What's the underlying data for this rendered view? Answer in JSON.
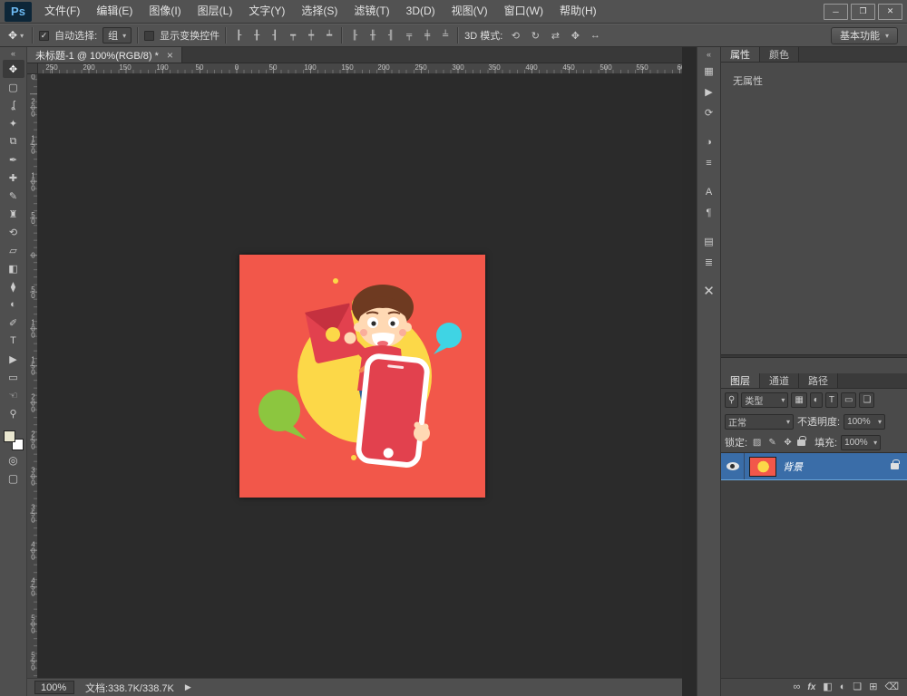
{
  "app": {
    "logo": "Ps",
    "menu": {
      "items": [
        "文件(F)",
        "编辑(E)",
        "图像(I)",
        "图层(L)",
        "文字(Y)",
        "选择(S)",
        "滤镜(T)",
        "3D(D)",
        "视图(V)",
        "窗口(W)",
        "帮助(H)"
      ]
    },
    "window_controls": {
      "minimize": "─",
      "maximize": "❐",
      "close": "✕"
    }
  },
  "glyphs": {
    "chevron_down": "▾",
    "check": "✓",
    "collapse": "«",
    "tab_close": "×"
  },
  "options_bar": {
    "tool_glyph": "✥",
    "auto_select_label": "自动选择:",
    "target_value": "组",
    "show_transform_label": "显示变换控件",
    "align_icons": [
      "┠",
      "╂",
      "┨",
      "┯",
      "┿",
      "┷"
    ],
    "distribute_icons": [
      "╟",
      "╫",
      "╢",
      "╤",
      "╪",
      "╧"
    ],
    "mode_3d_label": "3D 模式:",
    "mode_3d_icons": [
      "⟲",
      "↻",
      "⇄",
      "✥",
      "↔"
    ],
    "workspace_label": "基本功能"
  },
  "document": {
    "tab_title": "未标题-1 @ 100%(RGB/8) *"
  },
  "rulers": {
    "horizontal": [
      "250",
      "200",
      "150",
      "100",
      "50",
      "0",
      "50",
      "100",
      "150",
      "200",
      "250",
      "300",
      "350",
      "400",
      "450",
      "500",
      "550",
      "60"
    ],
    "vertical": [
      "250",
      "200",
      "150",
      "100",
      "50",
      "0",
      "50",
      "100",
      "150",
      "200",
      "250",
      "300",
      "350",
      "400",
      "450",
      "500",
      "550"
    ]
  },
  "toolbar": {
    "tools": [
      {
        "name": "move",
        "glyph": "✥"
      },
      {
        "name": "rectangular-marquee",
        "glyph": "▢"
      },
      {
        "name": "lasso",
        "glyph": "ʆ"
      },
      {
        "name": "quick-selection",
        "glyph": "✦"
      },
      {
        "name": "crop",
        "glyph": "⧉"
      },
      {
        "name": "eyedropper",
        "glyph": "✒"
      },
      {
        "name": "healing-brush",
        "glyph": "✚"
      },
      {
        "name": "brush",
        "glyph": "✎"
      },
      {
        "name": "clone-stamp",
        "glyph": "♜"
      },
      {
        "name": "history-brush",
        "glyph": "⟲"
      },
      {
        "name": "eraser",
        "glyph": "▱"
      },
      {
        "name": "gradient",
        "glyph": "◧"
      },
      {
        "name": "blur",
        "glyph": "⧫"
      },
      {
        "name": "dodge",
        "glyph": "◐"
      },
      {
        "name": "pen",
        "glyph": "✐"
      },
      {
        "name": "type",
        "glyph": "T"
      },
      {
        "name": "path-selection",
        "glyph": "▶"
      },
      {
        "name": "rectangle-shape",
        "glyph": "▭"
      },
      {
        "name": "hand",
        "glyph": "☜"
      },
      {
        "name": "zoom",
        "glyph": "⚲"
      }
    ],
    "quick_mask_glyph": "◎",
    "screen_mode_glyph": "▢"
  },
  "dock_strip": {
    "icons": [
      {
        "name": "grid-panel",
        "glyph": "▦"
      },
      {
        "name": "play",
        "glyph": "▶"
      },
      {
        "name": "refresh",
        "glyph": "⟳"
      },
      {
        "name": "half-circle",
        "glyph": "◑"
      },
      {
        "name": "list-lines",
        "glyph": "≡"
      },
      {
        "name": "letter-a",
        "glyph": "A"
      },
      {
        "name": "paragraph",
        "glyph": "¶"
      },
      {
        "name": "board",
        "glyph": "▤"
      },
      {
        "name": "stacked-lines",
        "glyph": "≣"
      },
      {
        "name": "x-mark",
        "glyph": "✕"
      }
    ]
  },
  "properties_panel": {
    "tabs": [
      "属性",
      "颜色"
    ],
    "empty_text": "无属性"
  },
  "layers_panel": {
    "tabs": [
      "图层",
      "通道",
      "路径"
    ],
    "filter": {
      "search_glyph": "⚲",
      "type_label": "类型",
      "icons": [
        {
          "name": "pixel-layers",
          "glyph": "▦"
        },
        {
          "name": "adjustment-layers",
          "glyph": "◐"
        },
        {
          "name": "type-layers",
          "glyph": "T"
        },
        {
          "name": "shape-layers",
          "glyph": "▭"
        },
        {
          "name": "smart-objects",
          "glyph": "❏"
        }
      ]
    },
    "blend": {
      "value": "正常",
      "opacity_label": "不透明度:",
      "opacity_value": "100%"
    },
    "lock": {
      "label": "锁定:",
      "icons": [
        {
          "name": "lock-transparency",
          "glyph": "▨"
        },
        {
          "name": "lock-pixels",
          "glyph": "✎"
        },
        {
          "name": "lock-position",
          "glyph": "✥"
        }
      ],
      "fill_label": "填充:",
      "fill_value": "100%"
    },
    "layer": {
      "name": "背景"
    },
    "bottom_icons": [
      {
        "name": "link",
        "glyph": "∞"
      },
      {
        "name": "effects",
        "glyph": "fx"
      },
      {
        "name": "layer-mask",
        "glyph": "◧"
      },
      {
        "name": "adjustment",
        "glyph": "◐"
      },
      {
        "name": "group-folder",
        "glyph": "❏"
      },
      {
        "name": "new-layer",
        "glyph": "⊞"
      },
      {
        "name": "trash",
        "glyph": "⌫"
      }
    ]
  },
  "status_bar": {
    "zoom": "100%",
    "doc_info": "文档:338.7K/338.7K",
    "arrow": "▶"
  },
  "palette": {
    "art-bg": "#f2574a",
    "art-yellow": "#fcd848",
    "art-green": "#8cc63f",
    "art-cyan": "#3fd4e4",
    "art-red": "#e2414e",
    "art-red-dark": "#c5313f",
    "art-skin": "#ffd9b4",
    "art-hair": "#6e3a21",
    "art-blue": "#2f5e94",
    "art-shoe": "#7a4a2a",
    "art-orange": "#f2884f",
    "art-blush": "#f9a898",
    "art-white": "#ffffff",
    "sel-blue": "#3a6da8"
  }
}
